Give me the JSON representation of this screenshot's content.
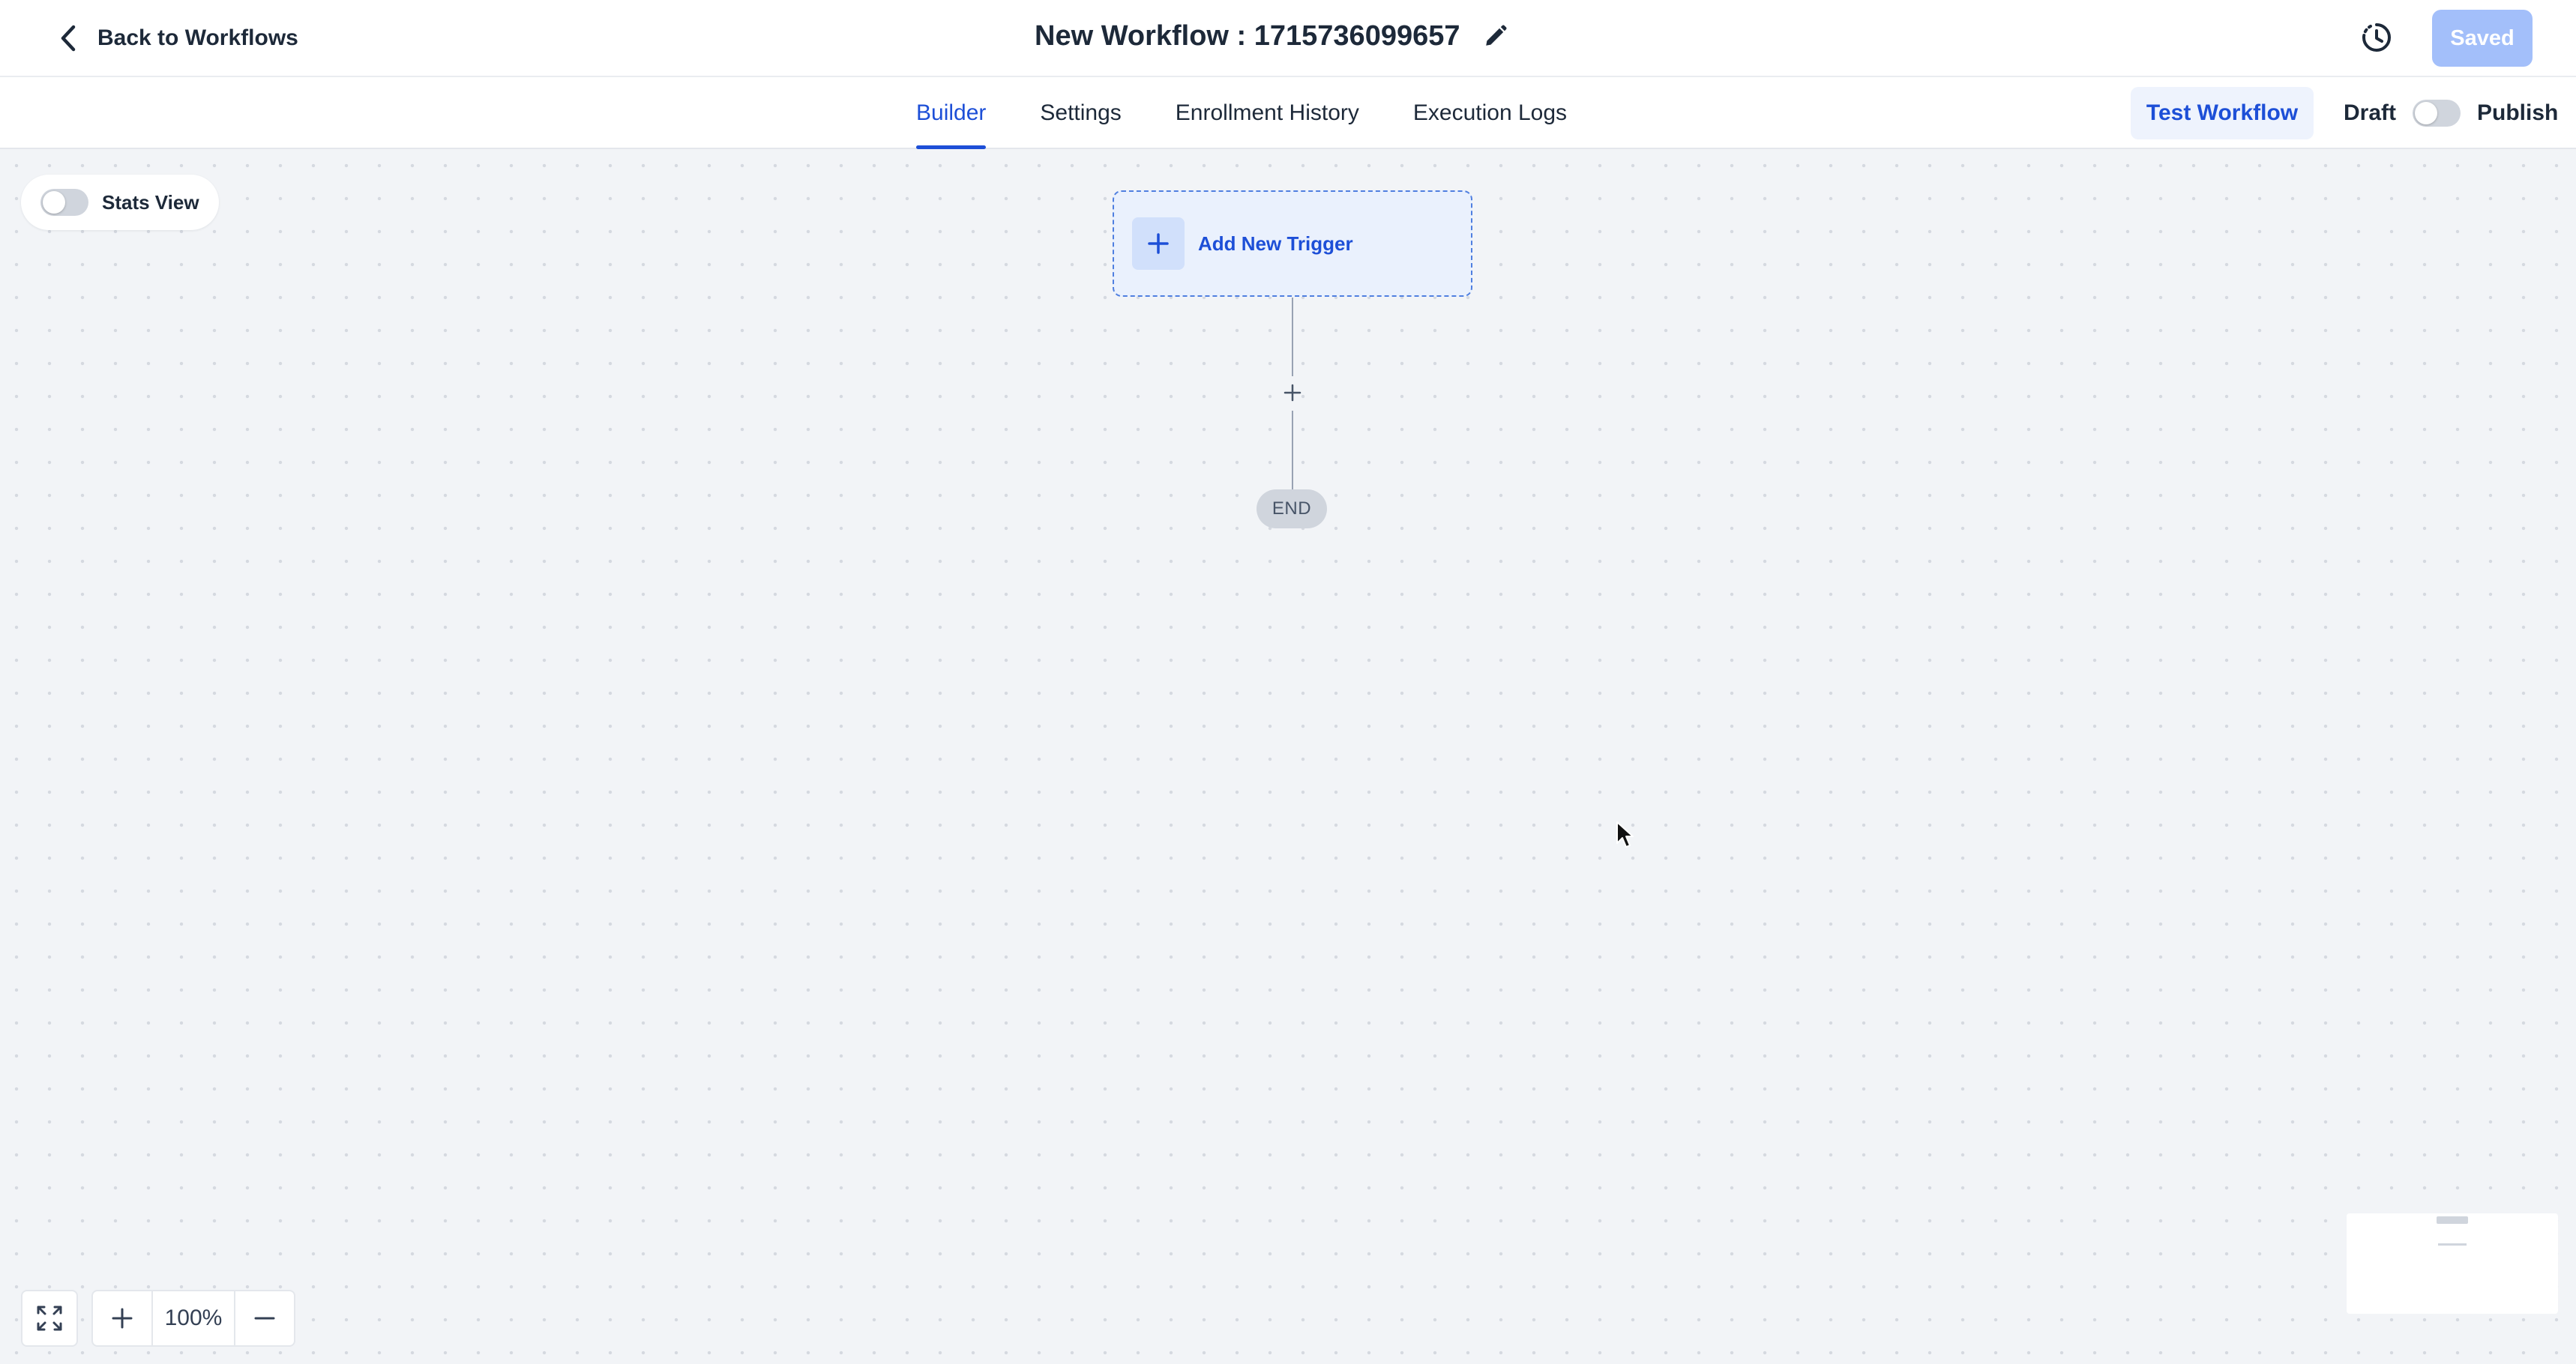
{
  "header": {
    "back_label": "Back to Workflows",
    "title": "New Workflow : 1715736099657",
    "saved_label": "Saved"
  },
  "tabs": [
    {
      "label": "Builder",
      "active": true
    },
    {
      "label": "Settings",
      "active": false
    },
    {
      "label": "Enrollment History",
      "active": false
    },
    {
      "label": "Execution Logs",
      "active": false
    }
  ],
  "actions": {
    "test_label": "Test Workflow",
    "draft_label": "Draft",
    "publish_label": "Publish",
    "published": false
  },
  "canvas": {
    "stats_view_label": "Stats View",
    "stats_view_on": false,
    "trigger_label": "Add New Trigger",
    "end_label": "END"
  },
  "zoom": {
    "level": "100%"
  },
  "icons": {
    "back": "chevron-left-icon",
    "edit": "pencil-icon",
    "history": "history-icon",
    "add_trigger": "plus-icon",
    "add_step": "plus-icon",
    "fit_view": "expand-icon",
    "zoom_in": "plus-icon",
    "zoom_out": "minus-icon"
  },
  "colors": {
    "accent": "#1d4fd7",
    "saved_button": "#a3bffa",
    "canvas": "#f2f4f7"
  }
}
